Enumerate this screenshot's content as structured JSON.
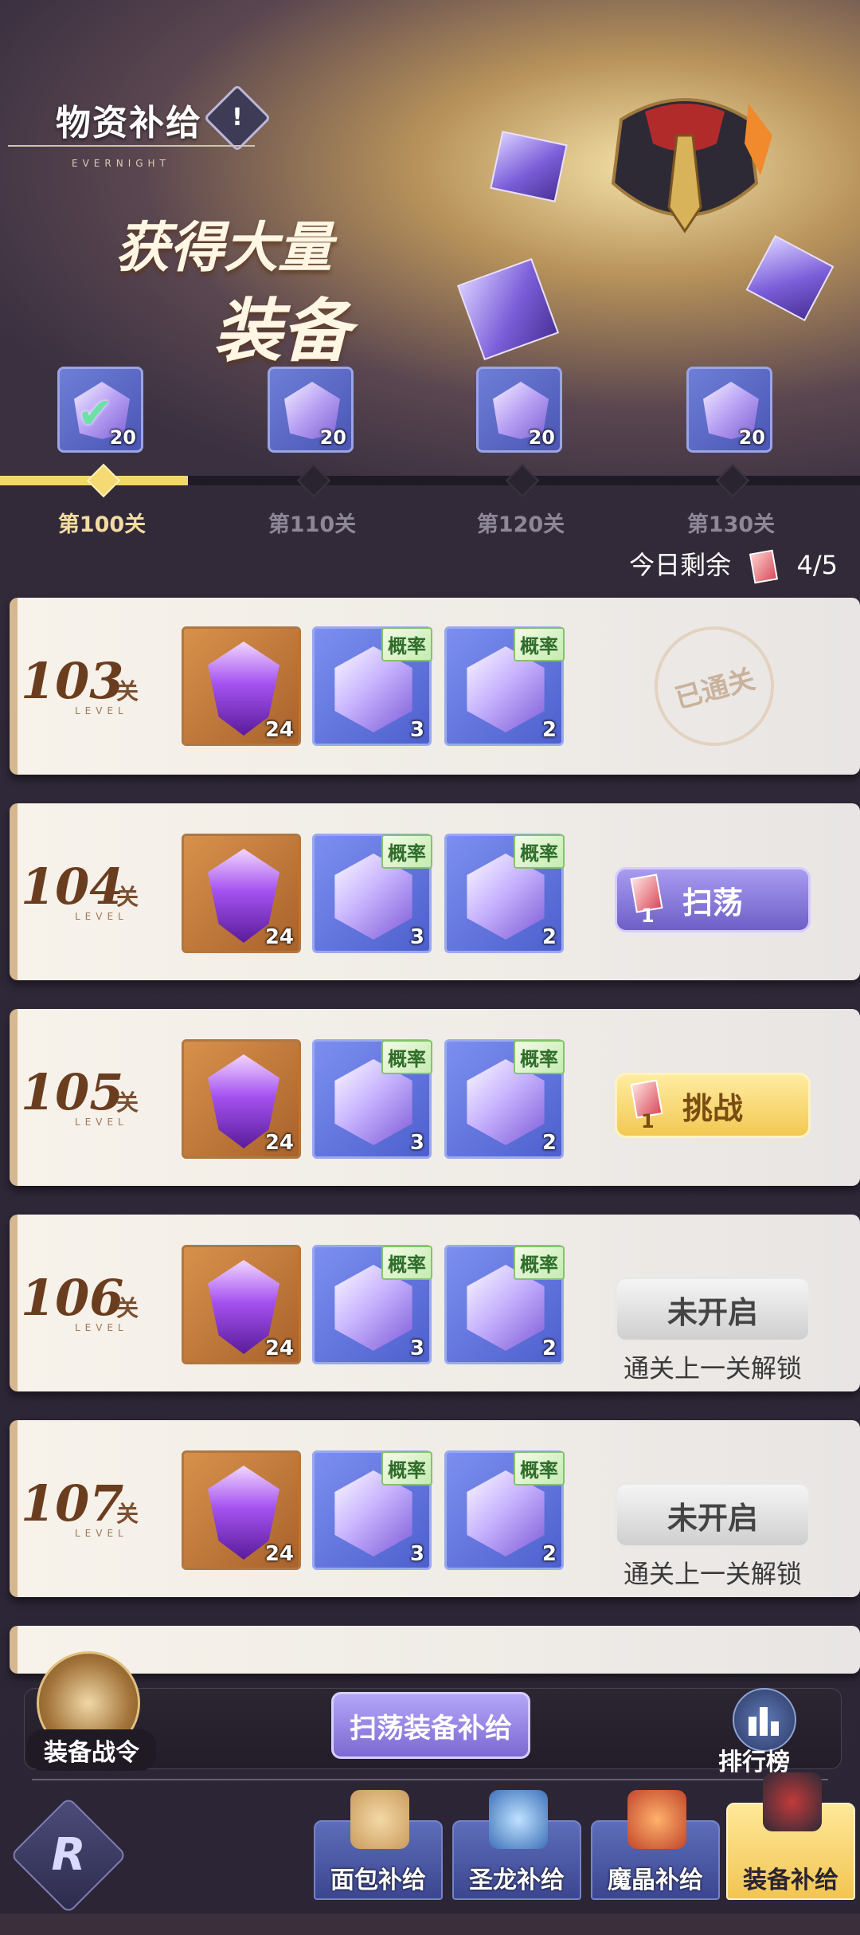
{
  "header": {
    "title": "物资补给",
    "title_sub": "EVERNIGHT",
    "hero_line1": "获得大量",
    "hero_line2": "装备",
    "info_icon": "!"
  },
  "milestones": [
    {
      "label": "第100关",
      "count": "20",
      "claimed": true
    },
    {
      "label": "第110关",
      "count": "20",
      "claimed": false
    },
    {
      "label": "第120关",
      "count": "20",
      "claimed": false
    },
    {
      "label": "第130关",
      "count": "20",
      "claimed": false
    }
  ],
  "progress_fraction": 0.22,
  "remaining": {
    "label": "今日剩余",
    "value": "4/5"
  },
  "rows": [
    {
      "level": "103",
      "unit": "关",
      "word": "LEVEL",
      "items": [
        {
          "count": "24"
        },
        {
          "count": "3",
          "tag": "概率"
        },
        {
          "count": "2",
          "tag": "概率"
        }
      ],
      "status": "cleared",
      "status_label": "已通关"
    },
    {
      "level": "104",
      "unit": "关",
      "word": "LEVEL",
      "items": [
        {
          "count": "24"
        },
        {
          "count": "3",
          "tag": "概率"
        },
        {
          "count": "2",
          "tag": "概率"
        }
      ],
      "status": "sweep",
      "status_label": "扫荡",
      "cost": "1"
    },
    {
      "level": "105",
      "unit": "关",
      "word": "LEVEL",
      "items": [
        {
          "count": "24"
        },
        {
          "count": "3",
          "tag": "概率"
        },
        {
          "count": "2",
          "tag": "概率"
        }
      ],
      "status": "challenge",
      "status_label": "挑战",
      "cost": "1"
    },
    {
      "level": "106",
      "unit": "关",
      "word": "LEVEL",
      "items": [
        {
          "count": "24"
        },
        {
          "count": "3",
          "tag": "概率"
        },
        {
          "count": "2",
          "tag": "概率"
        }
      ],
      "status": "locked",
      "status_label": "未开启",
      "hint": "通关上一关解锁"
    },
    {
      "level": "107",
      "unit": "关",
      "word": "LEVEL",
      "items": [
        {
          "count": "24"
        },
        {
          "count": "3",
          "tag": "概率"
        },
        {
          "count": "2",
          "tag": "概率"
        }
      ],
      "status": "locked",
      "status_label": "未开启",
      "hint": "通关上一关解锁"
    }
  ],
  "bottom": {
    "battle_pass": "装备战令",
    "sweep_supply": "扫荡装备补给",
    "ranking": "排行榜"
  },
  "tabs": [
    {
      "label": "面包补给",
      "icon": "bread-icon"
    },
    {
      "label": "圣龙补给",
      "icon": "dragon-icon"
    },
    {
      "label": "魔晶补给",
      "icon": "magic-crystal-icon"
    },
    {
      "label": "装备补给",
      "icon": "equipment-icon",
      "active": true
    }
  ],
  "colors": {
    "accent_gold": "#f2d86b",
    "sweep_purple": "#7c69d1",
    "challenge_yellow": "#f3c853"
  }
}
